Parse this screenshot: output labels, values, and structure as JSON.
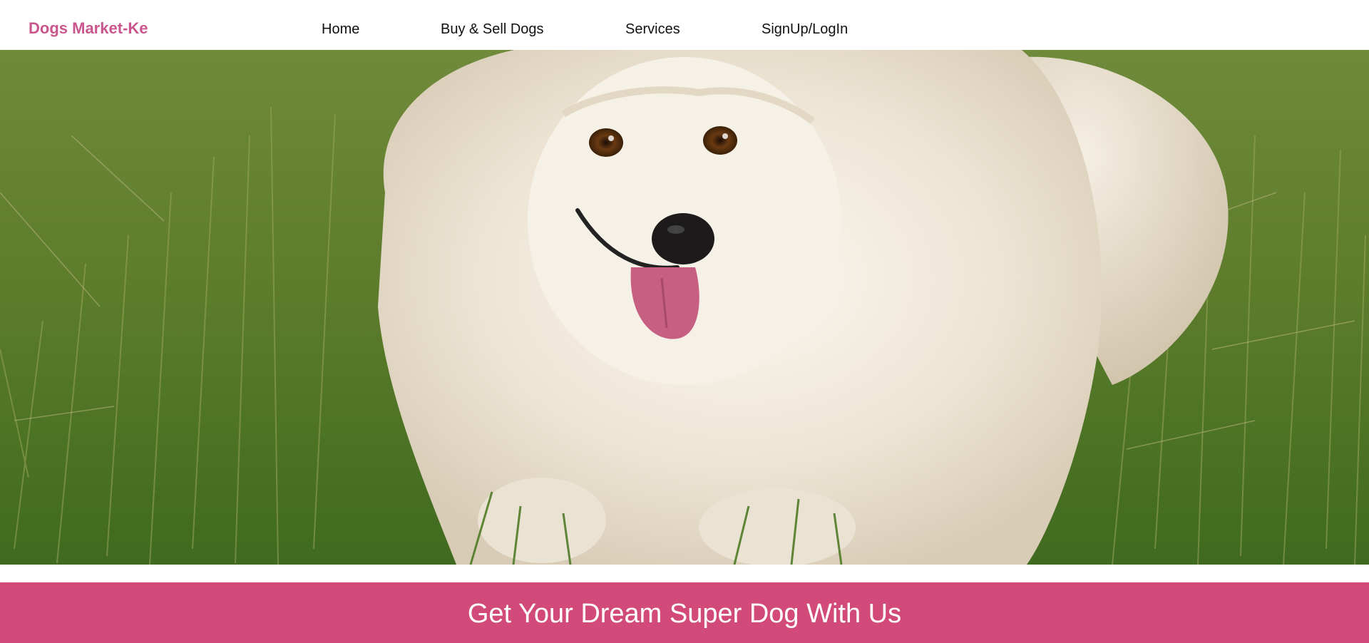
{
  "header": {
    "brand": "Dogs Market-Ke",
    "nav": {
      "home": "Home",
      "buy_sell": "Buy & Sell Dogs",
      "services": "Services",
      "signup_login": "SignUp/LogIn"
    }
  },
  "hero": {
    "image_subject": "white fluffy dog on grass"
  },
  "banner": {
    "title": "Get Your Dream Super Dog With Us"
  },
  "colors": {
    "brand": "#c9568d",
    "banner": "#d14a79",
    "nav_text": "#111111"
  }
}
